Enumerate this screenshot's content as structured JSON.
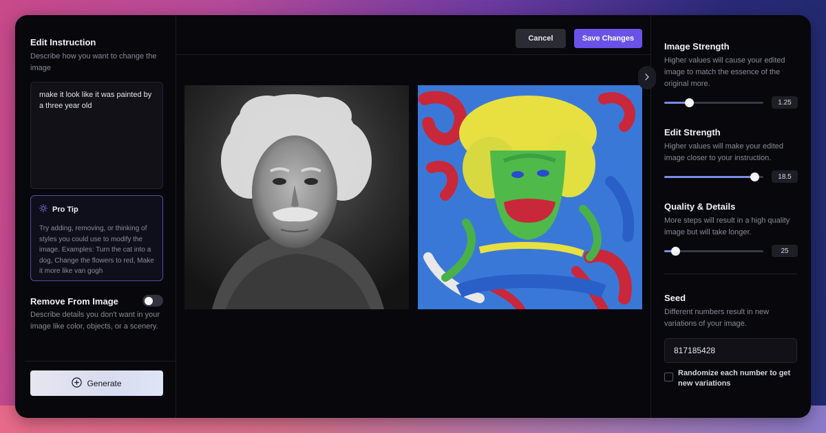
{
  "left": {
    "instruction_title": "Edit Instruction",
    "instruction_desc": "Describe how you want to change the image",
    "instruction_value": "make it look like it was painted by a three year old",
    "tip_title": "Pro Tip",
    "tip_text": "Try adding, removing, or thinking of styles you could use to modify the image. Examples: Turn the cat into a dog, Change the flowers to red, Make it more like van gogh",
    "remove_title": "Remove From Image",
    "remove_toggle_on": false,
    "remove_desc": "Describe details you don't want in your image like color, objects, or a scenery.",
    "generate_label": "Generate"
  },
  "toolbar": {
    "cancel_label": "Cancel",
    "save_label": "Save Changes"
  },
  "right": {
    "image_strength": {
      "title": "Image Strength",
      "desc": "Higher values will cause your edited image to match the essence of the original more.",
      "value": "1.25",
      "fraction": 0.25
    },
    "edit_strength": {
      "title": "Edit Strength",
      "desc": "Higher values will make your edited image closer to your instruction.",
      "value": "18.5",
      "fraction": 0.91
    },
    "quality": {
      "title": "Quality & Details",
      "desc": "More steps will result in a high quality image but will take longer.",
      "value": "25",
      "fraction": 0.11
    },
    "seed": {
      "title": "Seed",
      "desc": "Different numbers result in new variations of your image.",
      "value": "817185428",
      "randomize_label": "Randomize each number to get new variations"
    }
  },
  "colors": {
    "accent": "#6a52e8",
    "slider_fill": "#7c8ce8",
    "tip_border": "#5a4ca8"
  },
  "icons": {
    "tip": "sun-icon",
    "generate": "plus-circle-icon",
    "expand": "chevron-right-icon"
  }
}
